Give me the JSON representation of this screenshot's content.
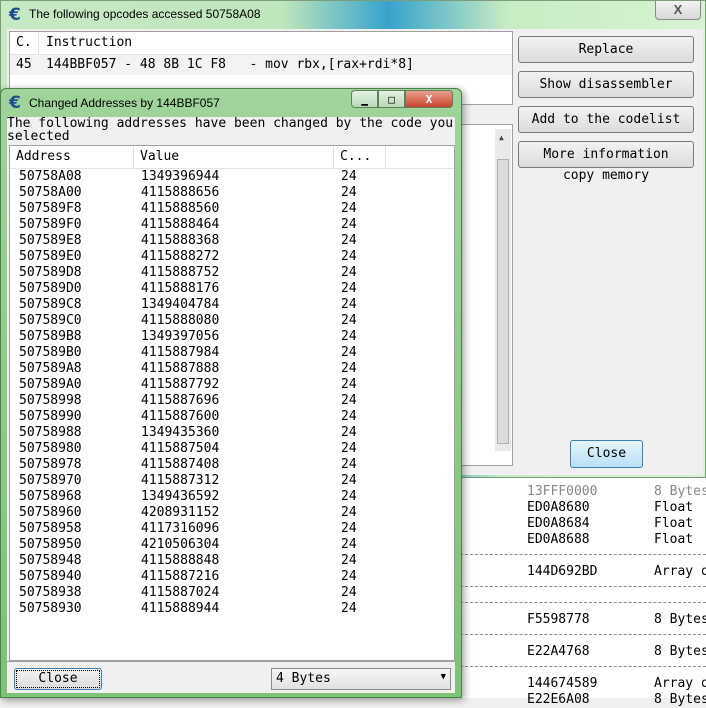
{
  "opcodes_window": {
    "title": "The following opcodes accessed 50758A08",
    "columns": [
      "C.",
      "Instruction"
    ],
    "rows": [
      {
        "count": "45",
        "instruction": "144BBF057 - 48 8B 1C F8   - mov rbx,[rax+rdi*8]"
      }
    ],
    "buttons": {
      "replace": "Replace",
      "show_disassembler": "Show disassembler",
      "add_codelist": "Add to the codelist",
      "more_info": "More information"
    },
    "copy_memory": "copy memory",
    "close": "Close",
    "close_icon": "X"
  },
  "memory_list": [
    {
      "addr": "13FFF0000",
      "type": "8 Bytes",
      "dim": true
    },
    {
      "addr": "ED0A8680",
      "type": "Float"
    },
    {
      "addr": "ED0A8684",
      "type": "Float"
    },
    {
      "addr": "ED0A8688",
      "type": "Float"
    },
    {
      "addr": "144D692BD",
      "type": "Array o"
    },
    {
      "addr": "F5598778",
      "type": "8 Bytes"
    },
    {
      "addr": "E22A4768",
      "type": "8 Bytes"
    },
    {
      "addr": "144674589",
      "type": "Array o"
    },
    {
      "addr": "E22E6A08",
      "type": "8 Bytes"
    }
  ],
  "changed_window": {
    "title": "Changed Addresses by 144BBF057",
    "label": "The following addresses have been changed by the code you selected",
    "columns": [
      "Address",
      "Value",
      "C..."
    ],
    "rows": [
      [
        "50758A08",
        "1349396944",
        "24"
      ],
      [
        "50758A00",
        "4115888656",
        "24"
      ],
      [
        "507589F8",
        "4115888560",
        "24"
      ],
      [
        "507589F0",
        "4115888464",
        "24"
      ],
      [
        "507589E8",
        "4115888368",
        "24"
      ],
      [
        "507589E0",
        "4115888272",
        "24"
      ],
      [
        "507589D8",
        "4115888752",
        "24"
      ],
      [
        "507589D0",
        "4115888176",
        "24"
      ],
      [
        "507589C8",
        "1349404784",
        "24"
      ],
      [
        "507589C0",
        "4115888080",
        "24"
      ],
      [
        "507589B8",
        "1349397056",
        "24"
      ],
      [
        "507589B0",
        "4115887984",
        "24"
      ],
      [
        "507589A8",
        "4115887888",
        "24"
      ],
      [
        "507589A0",
        "4115887792",
        "24"
      ],
      [
        "50758998",
        "4115887696",
        "24"
      ],
      [
        "50758990",
        "4115887600",
        "24"
      ],
      [
        "50758988",
        "1349435360",
        "24"
      ],
      [
        "50758980",
        "4115887504",
        "24"
      ],
      [
        "50758978",
        "4115887408",
        "24"
      ],
      [
        "50758970",
        "4115887312",
        "24"
      ],
      [
        "50758968",
        "1349436592",
        "24"
      ],
      [
        "50758960",
        "4208931152",
        "24"
      ],
      [
        "50758958",
        "4117316096",
        "24"
      ],
      [
        "50758950",
        "4210506304",
        "24"
      ],
      [
        "50758948",
        "4115888848",
        "24"
      ],
      [
        "50758940",
        "4115887216",
        "24"
      ],
      [
        "50758938",
        "4115887024",
        "24"
      ],
      [
        "50758930",
        "4115888944",
        "24"
      ]
    ],
    "close": "Close",
    "type_select": "4 Bytes",
    "window_buttons": {
      "minimize": "▁",
      "maximize": "□",
      "close": "X"
    }
  }
}
